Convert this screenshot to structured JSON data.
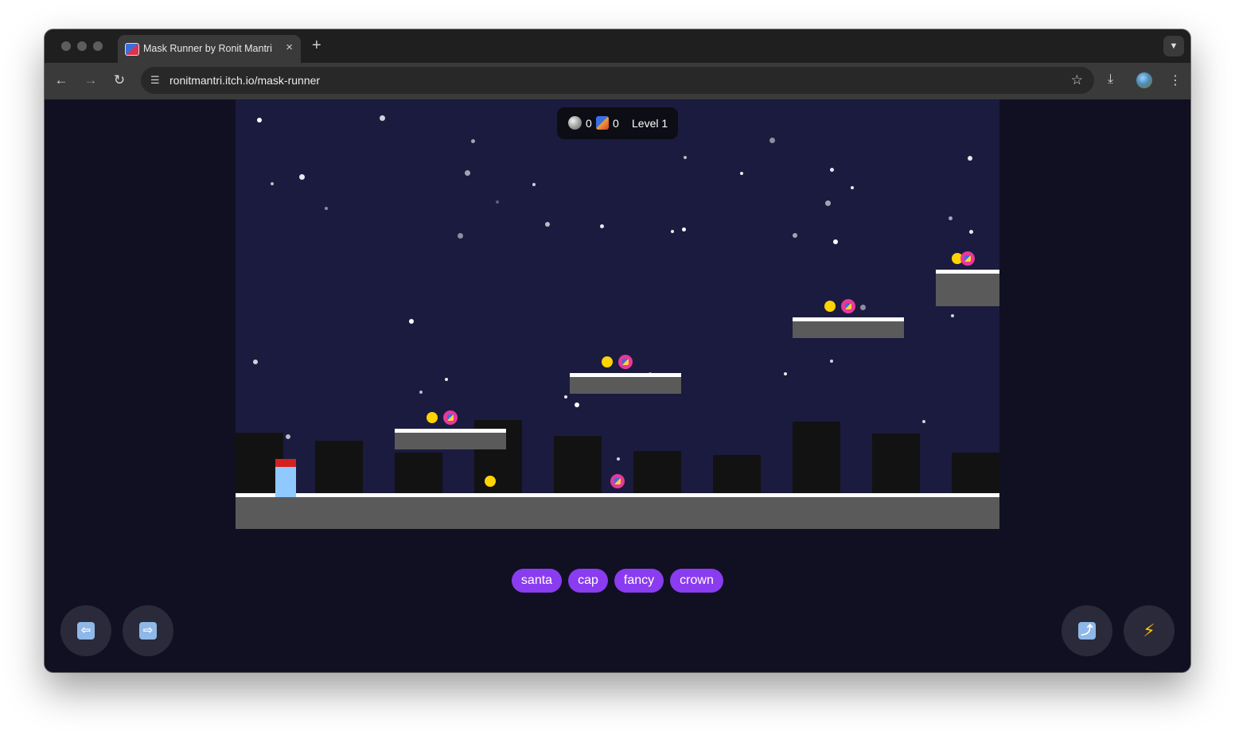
{
  "browser": {
    "tab_title": "Mask Runner by Ronit Mantri",
    "tab_close": "×",
    "new_tab": "+",
    "tab_search_icon": "chevron-down-icon",
    "back": "←",
    "forward": "→",
    "reload": "↻",
    "site_info_icon": "site-settings-icon",
    "url": "ronitmantri.itch.io/mask-runner",
    "bookmark": "☆",
    "download": "⤓",
    "menu": "⋮"
  },
  "hud": {
    "coins": "0",
    "masks": "0",
    "level": "Level 1"
  },
  "mask_buttons": [
    "santa",
    "cap",
    "fancy",
    "crown"
  ],
  "controls": {
    "left": "⇦",
    "right": "⇨",
    "jump": "⤴",
    "power": "⚡"
  },
  "colors": {
    "sky": "#1b1b3f",
    "coin": "#ffd400",
    "mask_token": "#e8389a",
    "mask_button": "#8a3cf0",
    "player_hat": "#d42020",
    "player_body": "#8fc9ff"
  }
}
